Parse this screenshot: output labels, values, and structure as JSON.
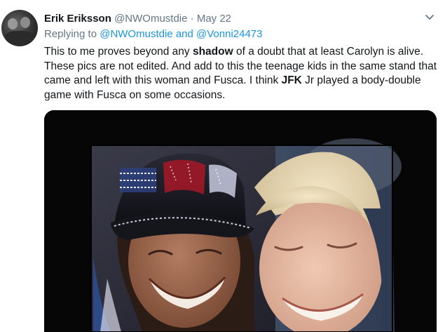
{
  "tweet": {
    "author_name": "Erik Eriksson",
    "handle": "@NWOmustdie",
    "separator": "·",
    "date": "May 22",
    "reply_prefix": "Replying to",
    "reply_user1": "@NWOmustdie",
    "reply_and": "and",
    "reply_user2": "@Vonni24473",
    "text": {
      "p1": "This to me proves beyond any ",
      "b1": "shadow",
      "p2": " of a doubt that at least Carolyn is alive. These pics are not edited. And add to this the teenage kids in the same stand that came and left with this woman and Fusca. I think ",
      "b2": "JFK",
      "p3": " Jr played a body-double game with Fusca on some occasions."
    },
    "icons": {
      "more": "chevron-down-icon",
      "avatar": "avatar"
    },
    "colors": {
      "link": "#1b95e0",
      "muted": "#657786",
      "text": "#14171a"
    }
  }
}
